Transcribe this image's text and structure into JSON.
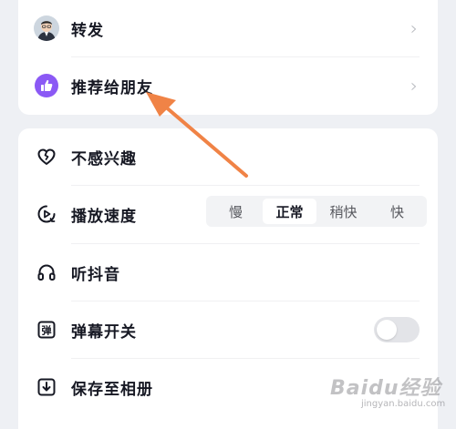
{
  "menu_top": {
    "items": [
      {
        "label": "转发",
        "icon": "avatar"
      },
      {
        "label": "推荐给朋友",
        "icon": "thumbs-up-icon"
      }
    ]
  },
  "menu_bottom": {
    "not_interested": {
      "label": "不感兴趣",
      "icon": "broken-heart-icon"
    },
    "playback_speed": {
      "label": "播放速度",
      "icon": "play-speed-icon",
      "options": [
        "慢",
        "正常",
        "稍快",
        "快"
      ],
      "selected": "正常"
    },
    "listen": {
      "label": "听抖音",
      "icon": "headphones-icon"
    },
    "danmaku": {
      "label": "弹幕开关",
      "icon": "danmaku-icon",
      "toggle_on": false
    },
    "save": {
      "label": "保存至相册",
      "icon": "download-icon"
    }
  },
  "colors": {
    "accent_purple": "#8b59f5",
    "annotation_arrow": "#f08346",
    "background": "#eef0f4"
  },
  "watermark": {
    "text": "Baidu经验",
    "sub": "jingyan.baidu.com"
  }
}
